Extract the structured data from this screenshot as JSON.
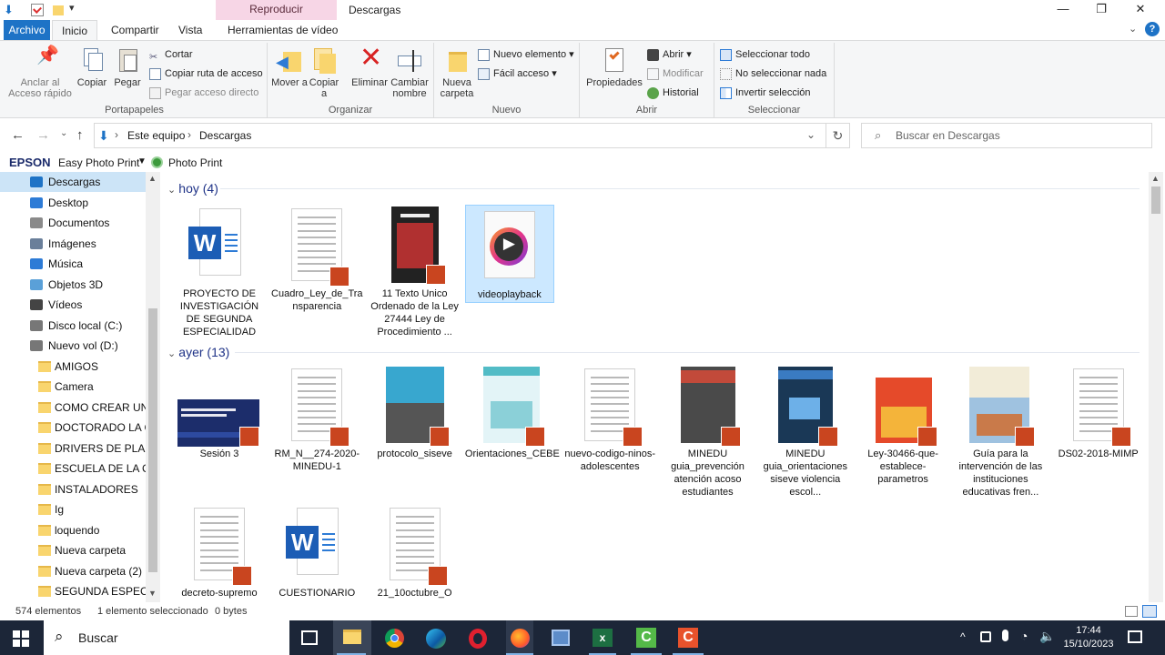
{
  "title_bar": {
    "context_tab": "Reproducir",
    "title": "Descargas",
    "minimize": "—",
    "maximize": "❐",
    "close": "✕"
  },
  "ribbon_tabs": [
    "Archivo",
    "Inicio",
    "Compartir",
    "Vista",
    "Herramientas de vídeo"
  ],
  "ribbon": {
    "portapapeles": {
      "anclar": "Anclar al Acceso rápido",
      "copiar": "Copiar",
      "pegar": "Pegar",
      "cortar": "Cortar",
      "copiar_ruta": "Copiar ruta de acceso",
      "pegar_acceso": "Pegar acceso directo",
      "label": "Portapapeles"
    },
    "organizar": {
      "mover": "Mover a",
      "copiar": "Copiar a",
      "eliminar": "Eliminar",
      "cambiar": "Cambiar nombre",
      "label": "Organizar"
    },
    "nuevo": {
      "nueva_carpeta": "Nueva carpeta",
      "nuevo_elemento": "Nuevo elemento",
      "facil_acceso": "Fácil acceso",
      "label": "Nuevo"
    },
    "abrir": {
      "propiedades": "Propiedades",
      "abrir": "Abrir",
      "modificar": "Modificar",
      "historial": "Historial",
      "label": "Abrir"
    },
    "seleccionar": {
      "todo": "Seleccionar todo",
      "nada": "No seleccionar nada",
      "invertir": "Invertir selección",
      "label": "Seleccionar"
    }
  },
  "address": {
    "crumbs": [
      "Este equipo",
      "Descargas"
    ],
    "search_placeholder": "Buscar en Descargas"
  },
  "epson": {
    "brand": "EPSON",
    "app": "Easy Photo Print",
    "photo": "Photo Print"
  },
  "nav": [
    {
      "label": "Descargas",
      "icon": "download-icon"
    },
    {
      "label": "Desktop",
      "icon": "desktop-icon"
    },
    {
      "label": "Documentos",
      "icon": "documents-icon"
    },
    {
      "label": "Imágenes",
      "icon": "pictures-icon"
    },
    {
      "label": "Música",
      "icon": "music-icon"
    },
    {
      "label": "Objetos 3D",
      "icon": "3d-objects-icon"
    },
    {
      "label": "Vídeos",
      "icon": "videos-icon"
    },
    {
      "label": "Disco local (C:)",
      "icon": "drive-icon"
    },
    {
      "label": "Nuevo vol (D:)",
      "icon": "drive-icon"
    },
    {
      "label": "AMIGOS",
      "icon": "folder-icon"
    },
    {
      "label": "Camera",
      "icon": "folder-icon"
    },
    {
      "label": "COMO CREAR UN TA",
      "icon": "folder-icon"
    },
    {
      "label": "DOCTORADO LA CA",
      "icon": "folder-icon"
    },
    {
      "label": "DRIVERS DE PLACA",
      "icon": "folder-icon"
    },
    {
      "label": "ESCUELA DE LA CON",
      "icon": "folder-icon"
    },
    {
      "label": "INSTALADORES",
      "icon": "folder-icon"
    },
    {
      "label": "Ig",
      "icon": "folder-icon"
    },
    {
      "label": "loquendo",
      "icon": "folder-icon"
    },
    {
      "label": "Nueva carpeta",
      "icon": "folder-icon"
    },
    {
      "label": "Nueva carpeta (2)",
      "icon": "folder-icon"
    },
    {
      "label": "SEGUNDA ESPECIAL",
      "icon": "folder-icon"
    }
  ],
  "groups": {
    "hoy": "hoy (4)",
    "ayer": "ayer (13)"
  },
  "files_hoy": [
    {
      "label": "PROYECTO DE INVESTIGACIÓN DE SEGUNDA ESPECIALIDAD",
      "kind": "word"
    },
    {
      "label": "Cuadro_Ley_de_Transparencia",
      "kind": "pdf-doc"
    },
    {
      "label": "11 Texto Unico Ordenado de la Ley 27444 Ley de Procedimiento ...",
      "kind": "pdf-book"
    },
    {
      "label": "videoplayback",
      "kind": "video"
    }
  ],
  "files_ayer": [
    {
      "label": "Sesión 3",
      "kind": "pdf-slide"
    },
    {
      "label": "RM_N__274-2020-MINEDU-1",
      "kind": "pdf-doc"
    },
    {
      "label": "protocolo_siseve",
      "kind": "pdf-cover"
    },
    {
      "label": "Orientaciones_CEBE",
      "kind": "pdf-cover2"
    },
    {
      "label": "nuevo-codigo-ninos-adolescentes",
      "kind": "pdf-doc"
    },
    {
      "label": "MINEDU guia_prevención atención acoso estudiantes",
      "kind": "pdf-photo"
    },
    {
      "label": "MINEDU guia_orientaciones siseve violencia escol...",
      "kind": "pdf-blue"
    },
    {
      "label": "Ley-30466-que-establece-parametros",
      "kind": "pdf-red"
    },
    {
      "label": "Guía para la intervención de las instituciones educativas fren...",
      "kind": "pdf-illus"
    },
    {
      "label": "DS02-2018-MIMP",
      "kind": "pdf-doc"
    },
    {
      "label": "decreto-supremo",
      "kind": "pdf-doc"
    },
    {
      "label": "CUESTIONARIO",
      "kind": "word"
    },
    {
      "label": "21_10octubre_O",
      "kind": "pdf-doc"
    }
  ],
  "status": {
    "count": "574 elementos",
    "selected": "1 elemento seleccionado",
    "size": "0 bytes"
  },
  "taskbar": {
    "search": "Buscar",
    "time": "17:44",
    "date": "15/10/2023"
  }
}
